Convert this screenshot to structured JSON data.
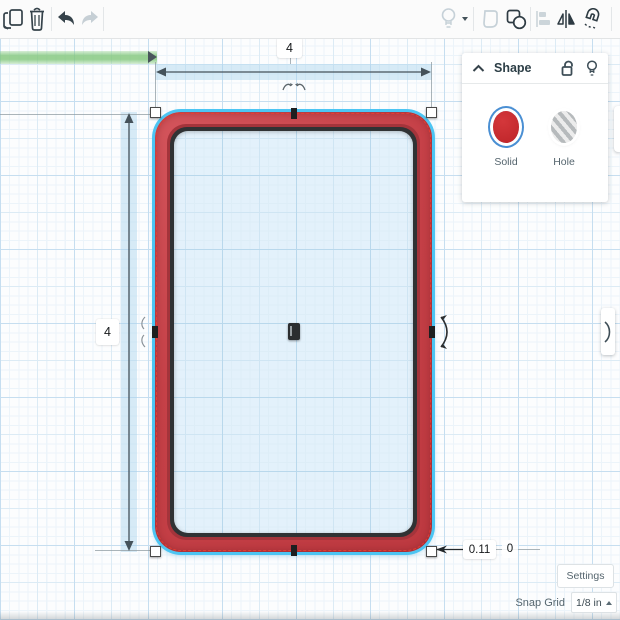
{
  "toolbar": {
    "left_icons": [
      "copy",
      "delete",
      "undo",
      "redo"
    ],
    "right_icons": [
      "lightbulb",
      "lightbulb-dropdown",
      "outline-shape",
      "group",
      "align",
      "mirror",
      "magnet"
    ]
  },
  "dimensions": {
    "width": "4",
    "height": "4",
    "radius": "0.11",
    "elevation": "0"
  },
  "shape_panel": {
    "title": "Shape",
    "solid_label": "Solid",
    "hole_label": "Hole",
    "header_icons": [
      "chevron-up",
      "unlock",
      "lightbulb"
    ]
  },
  "footer": {
    "settings_label": "Settings",
    "snap_grid_label": "Snap Grid",
    "snap_grid_value": "1/8 in"
  },
  "colors": {
    "shape_red": "#c64148",
    "selection_outline": "#4cc5f3",
    "dimension_band_blue": "#a8d2ee",
    "ruler_band_green": "#80c67a",
    "solid_swatch_red": "#c62d31",
    "swatch_ring_blue": "#4a8fd3"
  }
}
